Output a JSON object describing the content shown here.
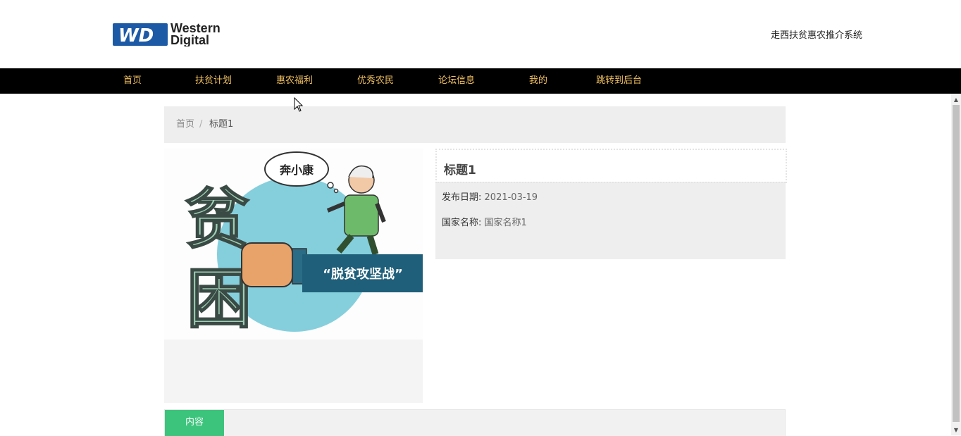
{
  "header": {
    "logo_text": [
      "Western",
      "Digital"
    ],
    "logo_mark": "WD",
    "site_title": "走西扶贫惠农推介系统"
  },
  "nav": {
    "items": [
      {
        "label": "首页"
      },
      {
        "label": "扶贫计划"
      },
      {
        "label": "惠农福利"
      },
      {
        "label": "优秀农民"
      },
      {
        "label": "论坛信息"
      },
      {
        "label": "我的"
      },
      {
        "label": "跳转到后台"
      }
    ],
    "text_color": "#f0c060"
  },
  "breadcrumb": {
    "home": "首页",
    "separator": "/",
    "current": "标题1"
  },
  "image": {
    "bubble_text": "奔小康",
    "banner_text": "“脱贫攻坚战”",
    "glyph_top": "贫",
    "glyph_bottom": "困"
  },
  "detail": {
    "title": "标题1",
    "publish_date_label": "发布日期:",
    "publish_date": "2021-03-19",
    "country_label": "国家名称:",
    "country": "国家名称1"
  },
  "tabs": {
    "active_label": "内容",
    "accent_color": "#3cc47c"
  }
}
